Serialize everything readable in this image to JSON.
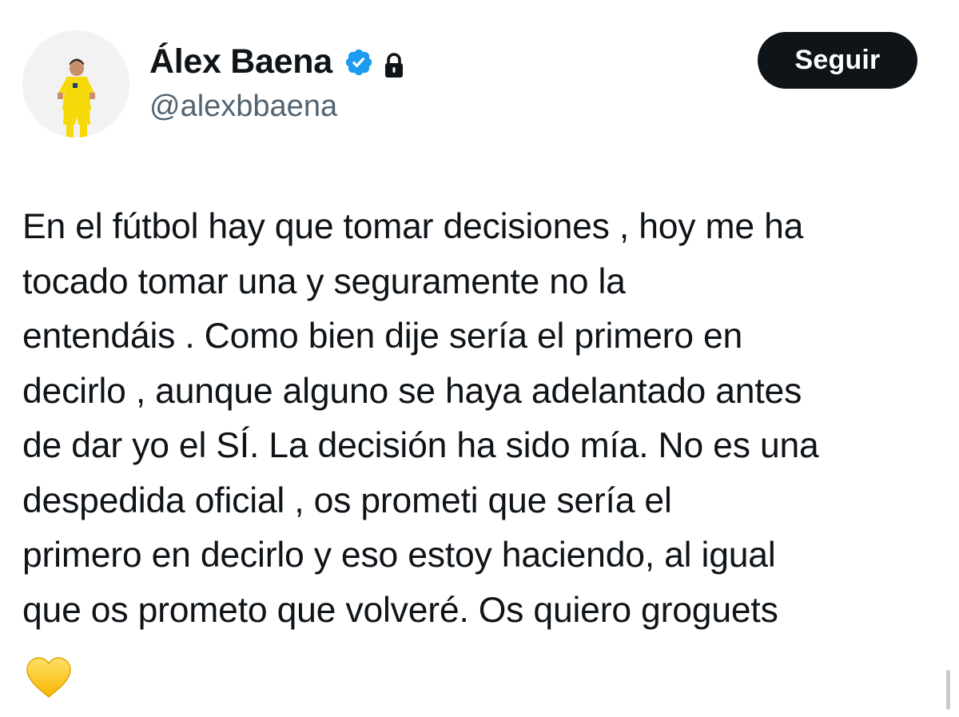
{
  "profile": {
    "display_name": "Álex Baena",
    "handle": "@alexbbaena",
    "avatar_icon": "player-avatar",
    "verified_icon": "verified-badge-icon",
    "protected_icon": "lock-icon",
    "verified_color": "#1d9bf0"
  },
  "actions": {
    "follow_label": "Seguir"
  },
  "tweet": {
    "lines": [
      "En el fútbol hay que tomar decisiones , hoy me ha",
      "tocado tomar una y seguramente no la",
      "entendáis . Como bien dije sería el primero en",
      "decirlo , aunque alguno se haya adelantado antes",
      "de dar yo el SÍ. La decisión ha sido mía. No es una",
      "despedida oficial , os prometi que sería el",
      "primero en decirlo y eso estoy haciendo, al igual",
      "que os prometo que volveré. Os quiero groguets"
    ],
    "emoji": "yellow-heart-icon",
    "emoji_color": "#ffcc33"
  }
}
